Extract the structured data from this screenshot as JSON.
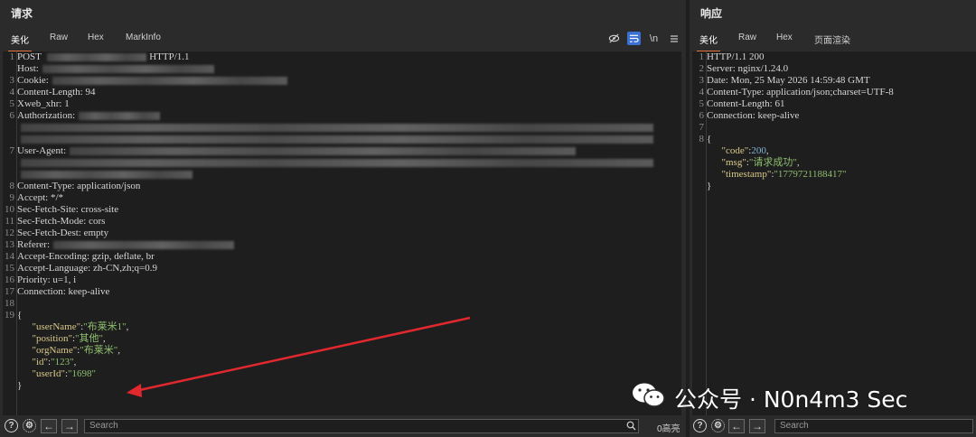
{
  "request": {
    "title": "请求",
    "tabs": [
      "美化",
      "Raw",
      "Hex",
      "MarkInfo"
    ],
    "lines": [
      {
        "n": "1",
        "t": "POST ",
        "redacted": true,
        "after": "HTTP/1.1"
      },
      {
        "n": "",
        "t": "Host:",
        "redacted": true
      },
      {
        "n": "3",
        "t": "Cookie:",
        "redacted": true
      },
      {
        "n": "4",
        "t": "Content-Length: 94"
      },
      {
        "n": "5",
        "t": "Xweb_xhr: 1"
      },
      {
        "n": "6",
        "t": "Authorization:",
        "redacted": true
      },
      {
        "n": "",
        "t": "",
        "redacted": true
      },
      {
        "n": "",
        "t": "",
        "redacted": true
      },
      {
        "n": "7",
        "t": "User-Agent:",
        "redacted": true
      },
      {
        "n": "",
        "t": "",
        "redacted": true
      },
      {
        "n": "",
        "t": "",
        "redacted": true
      },
      {
        "n": "8",
        "t": "Content-Type: application/json"
      },
      {
        "n": "9",
        "t": "Accept: */*"
      },
      {
        "n": "10",
        "t": "Sec-Fetch-Site: cross-site"
      },
      {
        "n": "11",
        "t": "Sec-Fetch-Mode: cors"
      },
      {
        "n": "12",
        "t": "Sec-Fetch-Dest: empty"
      },
      {
        "n": "13",
        "t": "Referer:",
        "redacted": true
      },
      {
        "n": "14",
        "t": "Accept-Encoding: gzip, deflate, br"
      },
      {
        "n": "15",
        "t": "Accept-Language: zh-CN,zh;q=0.9"
      },
      {
        "n": "16",
        "t": "Priority: u=1, i"
      },
      {
        "n": "17",
        "t": "Connection: keep-alive"
      },
      {
        "n": "18",
        "t": ""
      },
      {
        "n": "19",
        "t": "{"
      },
      {
        "n": "",
        "indent": true,
        "k": "\"userName\"",
        "v": "\"布莱米1\"",
        "tail": ","
      },
      {
        "n": "",
        "indent": true,
        "k": "\"position\"",
        "v": "\"其他\"",
        "tail": ","
      },
      {
        "n": "",
        "indent": true,
        "k": "\"orgName\"",
        "v": "\"布莱米\"",
        "tail": ","
      },
      {
        "n": "",
        "indent": true,
        "k": "\"id\"",
        "v": "\"123\"",
        "tail": ","
      },
      {
        "n": "",
        "indent": true,
        "k": "\"userId\"",
        "v": "\"1698\"",
        "tail": ""
      },
      {
        "n": "",
        "t": "}"
      }
    ],
    "search_placeholder": "Search",
    "highlight_count": "0高亮"
  },
  "response": {
    "title": "响应",
    "tabs": [
      "美化",
      "Raw",
      "Hex",
      "页面渲染"
    ],
    "lines": [
      {
        "n": "1",
        "t": "HTTP/1.1 200"
      },
      {
        "n": "2",
        "t": "Server: nginx/1.24.0"
      },
      {
        "n": "3",
        "t": "Date: Mon, 25 May 2026 14:59:48 GMT"
      },
      {
        "n": "4",
        "t": "Content-Type: application/json;charset=UTF-8"
      },
      {
        "n": "5",
        "t": "Content-Length: 61"
      },
      {
        "n": "6",
        "t": "Connection: keep-alive"
      },
      {
        "n": "7",
        "t": ""
      },
      {
        "n": "8",
        "t": "{"
      },
      {
        "n": "",
        "indent": true,
        "k": "\"code\"",
        "v": "200",
        "num": true,
        "tail": ","
      },
      {
        "n": "",
        "indent": true,
        "k": "\"msg\"",
        "v": "\"请求成功\"",
        "tail": ","
      },
      {
        "n": "",
        "indent": true,
        "k": "\"timestamp\"",
        "v": "\"1779721188417\"",
        "tail": ""
      },
      {
        "n": "",
        "t": "}"
      }
    ],
    "search_placeholder": "Search"
  },
  "toolbar_icons": [
    "eye-off-icon",
    "wrap-icon",
    "newline-icon",
    "menu-icon"
  ],
  "toolbar_newline_label": "\\n",
  "bottom_icons": [
    "help-icon",
    "settings-icon",
    "arrow-left-icon",
    "arrow-right-icon",
    "search-icon"
  ],
  "watermark": {
    "text": "公众号 · N0n4m3 Sec",
    "icon": "wechat-icon"
  },
  "colors": {
    "accent": "#e8743b",
    "arrow": "#e0282e",
    "key": "#d9c889",
    "string": "#8fbf6f",
    "number": "#7fb4d9"
  }
}
